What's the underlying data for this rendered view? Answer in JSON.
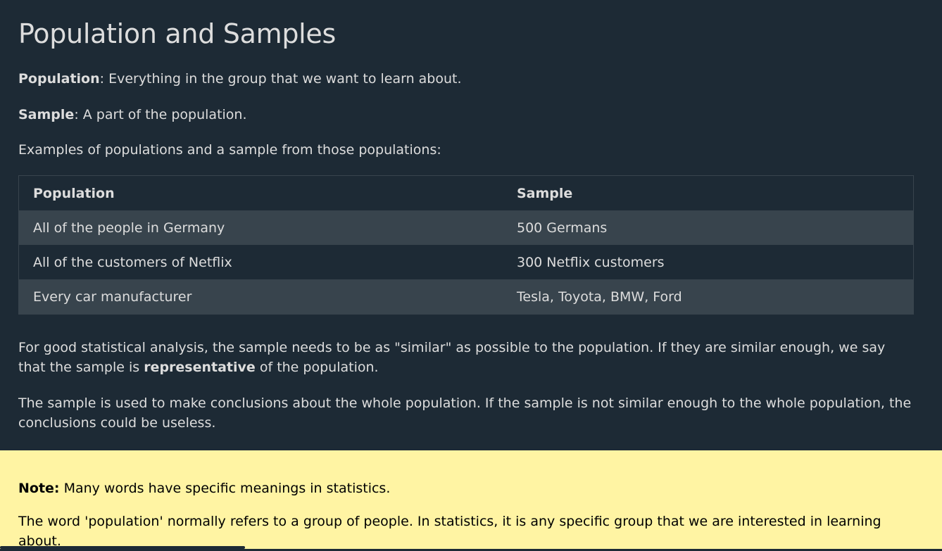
{
  "heading": "Population and Samples",
  "definitions": {
    "population_term": "Population",
    "population_text": ": Everything in the group that we want to learn about.",
    "sample_term": "Sample",
    "sample_text": ": A part of the population."
  },
  "examples_intro": "Examples of populations and a sample from those populations:",
  "table": {
    "headers": [
      "Population",
      "Sample"
    ],
    "rows": [
      [
        "All of the people in Germany",
        "500 Germans"
      ],
      [
        "All of the customers of Netflix",
        "300 Netflix customers"
      ],
      [
        "Every car manufacturer",
        "Tesla, Toyota, BMW, Ford"
      ]
    ]
  },
  "analysis": {
    "text_before": "For good statistical analysis, the sample needs to be as \"similar\" as possible to the population. If they are similar enough, we say that the sample is ",
    "bold": "representative",
    "text_after": " of the population."
  },
  "conclusion": "The sample is used to make conclusions about the whole population. If the sample is not similar enough to the whole population, the conclusions could be useless.",
  "note": {
    "label": "Note:",
    "text": " Many words have specific meanings in statistics.",
    "paragraph": "The word 'population' normally refers to a group of people. In statistics, it is any specific group that we are interested in learning about."
  },
  "colors": {
    "page_background": "#1d2a35",
    "table_row_shade": "#38444d",
    "note_background": "#fff4a3"
  }
}
